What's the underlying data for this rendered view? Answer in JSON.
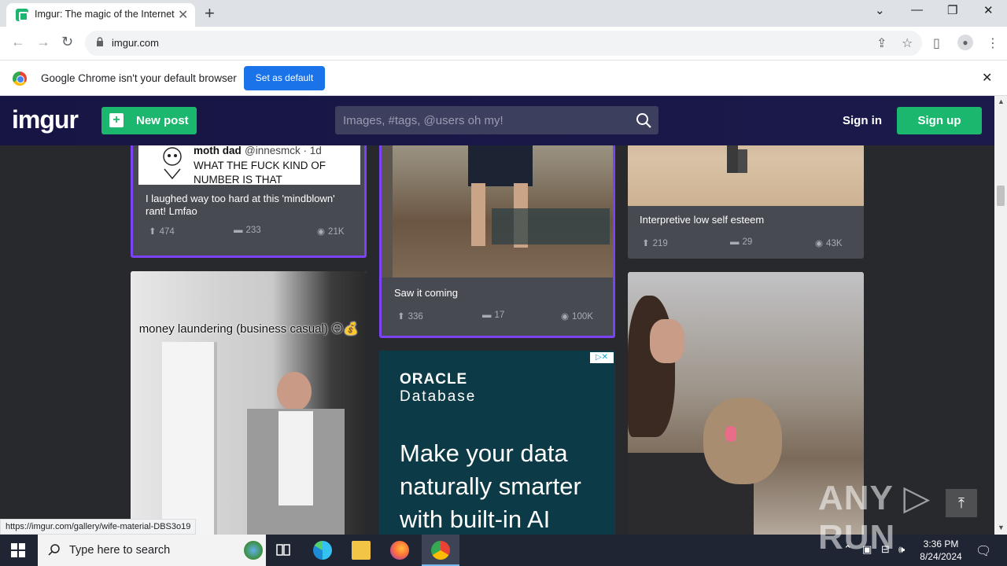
{
  "browser": {
    "tab_title": "Imgur: The magic of the Internet",
    "url": "imgur.com",
    "infobar_text": "Google Chrome isn't your default browser",
    "infobar_button": "Set as default",
    "status_url": "https://imgur.com/gallery/wife-material-DBS3o19"
  },
  "site": {
    "logo": "imgur",
    "new_post_label": "New post",
    "search_placeholder": "Images, #tags, @users oh my!",
    "sign_in": "Sign in",
    "sign_up": "Sign up"
  },
  "cards": [
    {
      "title": "I laughed way too hard at this 'mindblown' rant! Lmfao",
      "tweet_name": "moth dad",
      "tweet_handle": "@innesmck · 1d",
      "tweet_text": "WHAT THE FUCK KIND OF NUMBER IS THAT",
      "upvotes": "474",
      "comments": "233",
      "views": "21K"
    },
    {
      "title": "Saw it coming",
      "upvotes": "336",
      "comments": "17",
      "views": "100K"
    },
    {
      "title": "Interpretive low self esteem",
      "upvotes": "219",
      "comments": "29",
      "views": "43K"
    },
    {
      "caption": "money laundering (business casual) 😛💰"
    }
  ],
  "ad": {
    "brand": "ORACLE",
    "product": "Database",
    "headline": "Make your data naturally smarter with built-in AI",
    "badge": "▷✕"
  },
  "watermark": "ANY ▷ RUN",
  "taskbar": {
    "search_placeholder": "Type here to search",
    "time": "3:36 PM",
    "date": "8/24/2024"
  },
  "colors": {
    "imgur_green": "#1bb76e",
    "imgur_header": "#171544",
    "highlight_purple": "#7b42f6",
    "chrome_blue": "#1a73e8"
  }
}
